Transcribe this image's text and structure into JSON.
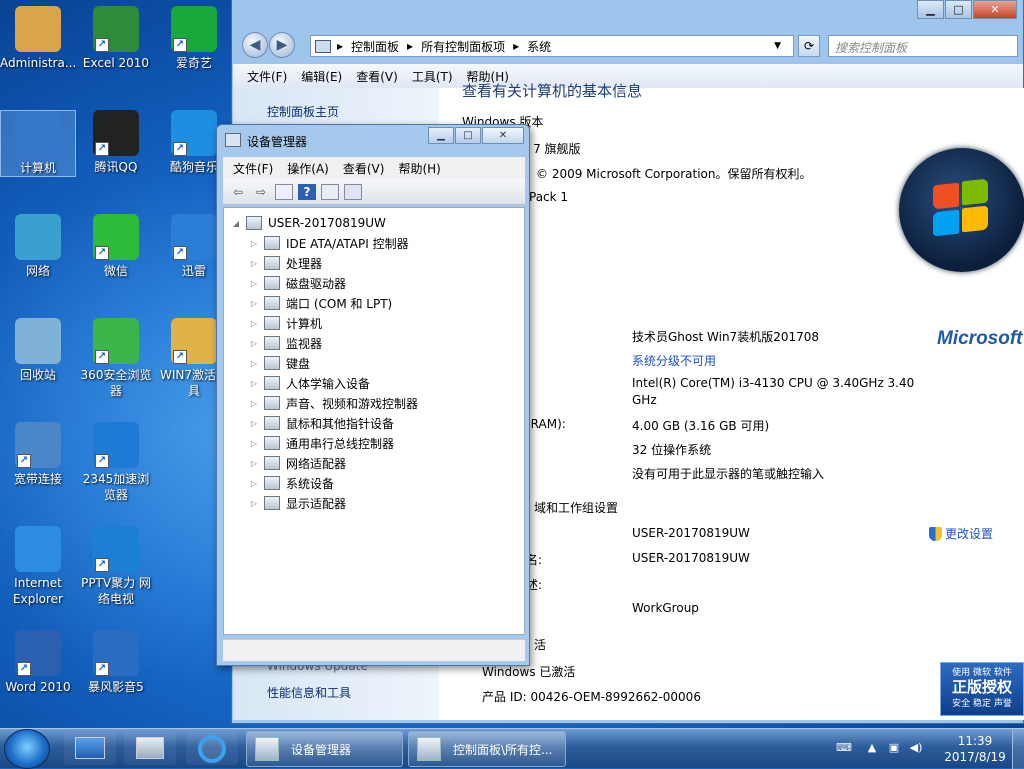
{
  "desktop": {
    "icons": [
      {
        "label": "Administra...",
        "color": "#d9a54a"
      },
      {
        "label": "Excel 2010",
        "color": "#2e8b3a"
      },
      {
        "label": "爱奇艺",
        "color": "#19a83a"
      },
      {
        "label": "计算机",
        "color": "#3578c8"
      },
      {
        "label": "腾讯QQ",
        "color": "#222222"
      },
      {
        "label": "酷狗音乐",
        "color": "#1e8ee0"
      },
      {
        "label": "网络",
        "color": "#3aa0d0"
      },
      {
        "label": "微信",
        "color": "#2dbb39"
      },
      {
        "label": "迅雷",
        "color": "#2a7ed6"
      },
      {
        "label": "回收站",
        "color": "#7fb2d6"
      },
      {
        "label": "360安全浏览器",
        "color": "#3cb64a"
      },
      {
        "label": "WIN7激活工具",
        "color": "#e0b24a"
      },
      {
        "label": "宽带连接",
        "color": "#4a86c8"
      },
      {
        "label": "2345加速浏览器",
        "color": "#1f7ad6"
      },
      {
        "label": "Internet Explorer",
        "color": "#2c8de0"
      },
      {
        "label": "PPTV聚力 网络电视",
        "color": "#1b7fd4"
      },
      {
        "label": "Word 2010",
        "color": "#2b5fb0"
      },
      {
        "label": "暴风影音5",
        "color": "#2a6cc4"
      }
    ]
  },
  "system_window": {
    "address_parts": [
      "控制面板",
      "所有控制面板项",
      "系统"
    ],
    "search_placeholder": "搜索控制面板",
    "menu": [
      "文件(F)",
      "编辑(E)",
      "查看(V)",
      "工具(T)",
      "帮助(H)"
    ],
    "left_links": {
      "home": "控制面板主页",
      "update": "Windows Update",
      "perf": "性能信息和工具"
    },
    "heading": "查看有关计算机的基本信息",
    "edition_title": "Windows 版本",
    "edition": "s 7 旗舰版",
    "copyright": "© 2009 Microsoft Corporation。保留所有权利。",
    "sp": "Pack 1",
    "manufacturer": "技术员Ghost Win7装机版201708",
    "rating": "系统分级不可用",
    "processor": "Intel(R) Core(TM) i3-4130 CPU @ 3.40GHz   3.40",
    "processor2": "GHz",
    "ram_label": "(RAM):",
    "ram": "4.00 GB (3.16 GB 可用)",
    "sys_type_sep": ":",
    "sys_type": "32 位操作系统",
    "pen_sep": ":",
    "pen": "没有可用于此显示器的笔或触控输入",
    "domain_title": "域和工作组设置",
    "change_settings": "更改设置",
    "computer_name_sep": ":",
    "computer_name": "USER-20170819UW",
    "full_name_label": "名:",
    "full_name": "USER-20170819UW",
    "desc_label": "述:",
    "workgroup": "WorkGroup",
    "activation_title": "活",
    "activated": "Windows 已激活",
    "product_id": "产品 ID: 00426-OEM-8992662-00006",
    "ms_logo": "Microsoft",
    "badge": {
      "line1": "使用 微软 软件",
      "line2": "正版授权",
      "line3": "安全 稳定 声誉"
    }
  },
  "device_manager": {
    "title": "设备管理器",
    "menu": [
      "文件(F)",
      "操作(A)",
      "查看(V)",
      "帮助(H)"
    ],
    "root": "USER-20170819UW",
    "nodes": [
      "IDE ATA/ATAPI 控制器",
      "处理器",
      "磁盘驱动器",
      "端口 (COM 和 LPT)",
      "计算机",
      "监视器",
      "键盘",
      "人体学输入设备",
      "声音、视频和游戏控制器",
      "鼠标和其他指针设备",
      "通用串行总线控制器",
      "网络适配器",
      "系统设备",
      "显示适配器"
    ]
  },
  "taskbar": {
    "tasks": [
      "设备管理器",
      "控制面板\\所有控..."
    ],
    "time": "11:39",
    "date": "2017/8/19"
  }
}
